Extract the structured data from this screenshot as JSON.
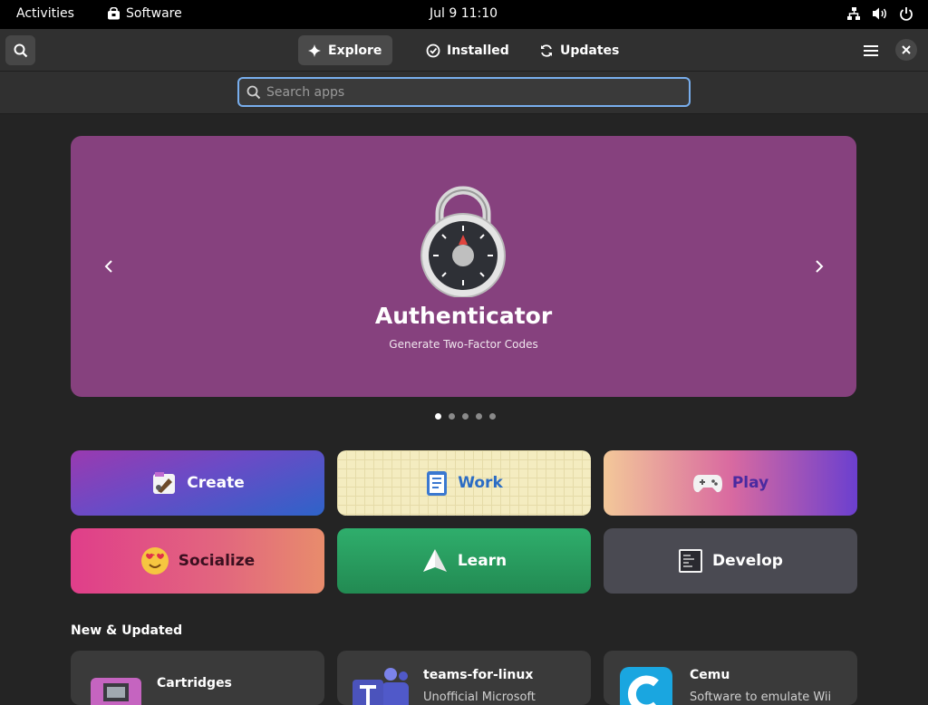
{
  "topbar": {
    "activities": "Activities",
    "app_name": "Software",
    "clock": "Jul 9  11:10"
  },
  "header": {
    "tabs": [
      {
        "label": "Explore",
        "active": true
      },
      {
        "label": "Installed",
        "active": false
      },
      {
        "label": "Updates",
        "active": false
      }
    ]
  },
  "search": {
    "placeholder": "Search apps",
    "value": ""
  },
  "carousel": {
    "title": "Authenticator",
    "subtitle": "Generate Two-Factor Codes",
    "background_color": "#86417e",
    "page_count": 5,
    "current_page": 1
  },
  "categories": [
    {
      "label": "Create"
    },
    {
      "label": "Work"
    },
    {
      "label": "Play"
    },
    {
      "label": "Socialize"
    },
    {
      "label": "Learn"
    },
    {
      "label": "Develop"
    }
  ],
  "new_updated": {
    "title": "New & Updated",
    "apps": [
      {
        "name": "Cartridges",
        "description": ""
      },
      {
        "name": "teams-for-linux",
        "description": "Unofficial Microsoft"
      },
      {
        "name": "Cemu",
        "description": "Software to emulate Wii"
      }
    ]
  },
  "colors": {
    "accent": "#78aeed",
    "background": "#242424",
    "headerbar": "#303030"
  }
}
